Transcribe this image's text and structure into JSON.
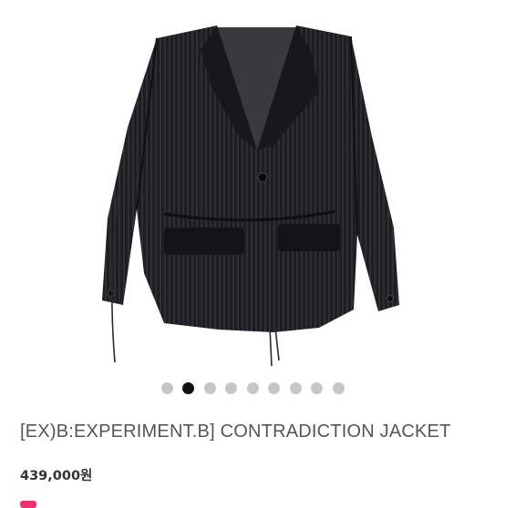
{
  "product": {
    "image_alt": "corduroy jacket product photo",
    "title": "[EX)B:EXPERIMENT.B] CONTRADICTION JACKET",
    "price": "439,000원"
  },
  "carousel": {
    "total": 9,
    "active_index": 1
  },
  "colors": {
    "active_dot": "#111111",
    "inactive_dot": "#c6c6c6",
    "accent": "#e8336e"
  }
}
